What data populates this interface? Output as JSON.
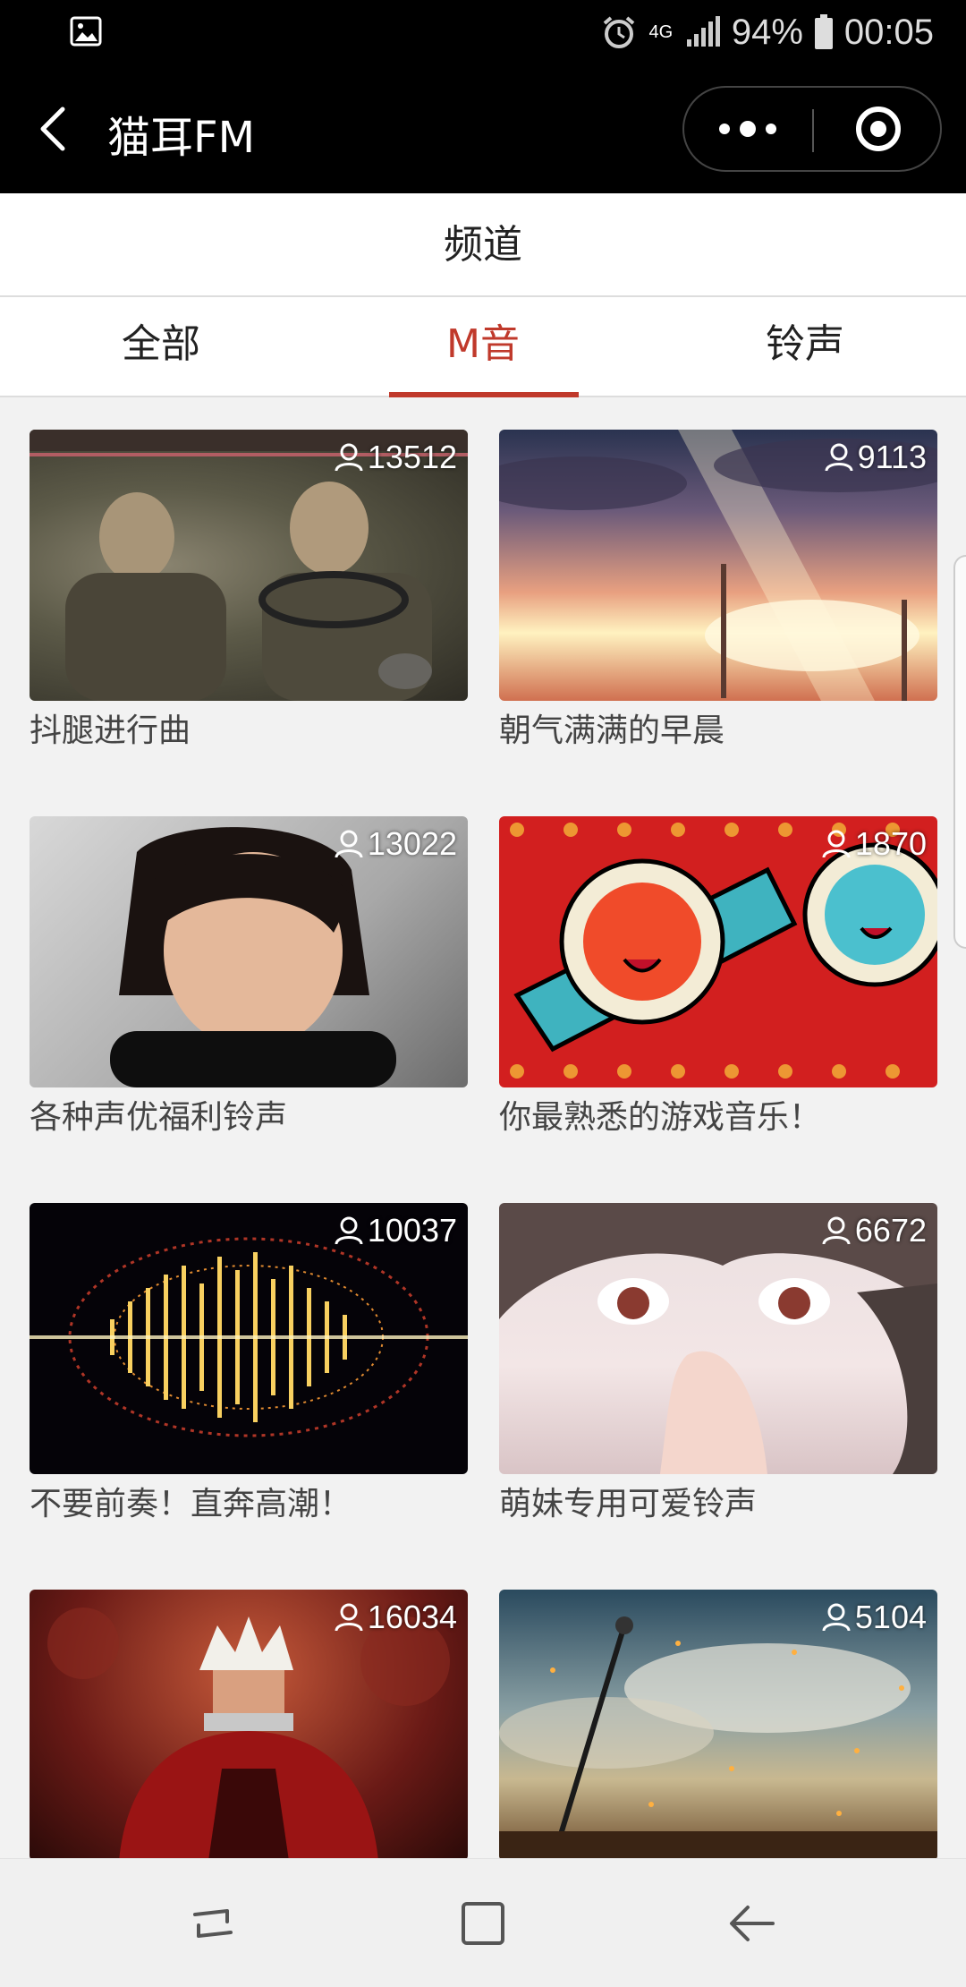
{
  "status_bar": {
    "network": "4G",
    "battery": "94%",
    "time": "00:05"
  },
  "header": {
    "title": "猫耳FM"
  },
  "page": {
    "title": "频道"
  },
  "tabs": [
    {
      "label": "全部",
      "active": false
    },
    {
      "label": "M音",
      "active": true
    },
    {
      "label": "铃声",
      "active": false
    }
  ],
  "accent_color": "#c0392b",
  "channels": [
    {
      "title": "抖腿进行曲",
      "listeners": "13512"
    },
    {
      "title": "朝气满满的早晨",
      "listeners": "9113"
    },
    {
      "title": "各种声优福利铃声",
      "listeners": "13022"
    },
    {
      "title": "你最熟悉的游戏音乐！",
      "listeners": "1870"
    },
    {
      "title": "不要前奏！直奔高潮！",
      "listeners": "10037"
    },
    {
      "title": "萌妹专用可爱铃声",
      "listeners": "6672"
    },
    {
      "title": "",
      "listeners": "16034"
    },
    {
      "title": "",
      "listeners": "5104"
    }
  ]
}
